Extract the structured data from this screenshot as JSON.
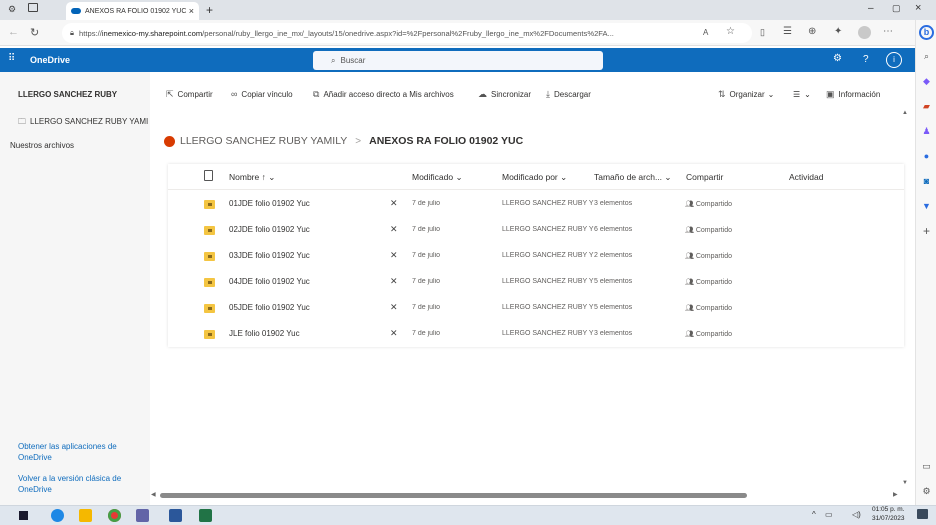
{
  "browser": {
    "tab_title": "ANEXOS RA FOLIO 01902 YUC -",
    "tab_close": "×",
    "new_tab": "+",
    "url_prefix": "https://",
    "url_host": "inemexico-my.sharepoint.com",
    "url_path": "/personal/ruby_llergo_ine_mx/_layouts/15/onedrive.aspx?id=%2Fpersonal%2Fruby_llergo_ine_mx%2FDocuments%2FA...",
    "window_controls": [
      "–",
      "▢",
      "×"
    ]
  },
  "suite": {
    "app_name": "OneDrive",
    "search_placeholder": "Buscar",
    "user_initial": "i",
    "help": "?"
  },
  "left_pane": {
    "user_name": "LLERGO SANCHEZ RUBY",
    "folder_item": "LLERGO SANCHEZ RUBY YAMI",
    "section": "Nuestros archivos",
    "get_apps": "Obtener las aplicaciones de OneDrive",
    "classic": "Volver a la versión clásica de OneDrive"
  },
  "commands": {
    "share": "Compartir",
    "copy_link": "Copiar vínculo",
    "add_shortcut": "Añadir acceso directo a Mis archivos",
    "sync": "Sincronizar",
    "download": "Descargar",
    "organize": "Organizar",
    "info": "Información"
  },
  "breadcrumb": {
    "root": "LLERGO SANCHEZ RUBY YAMILY",
    "separator": ">",
    "current": "ANEXOS RA FOLIO 01902 YUC"
  },
  "columns": {
    "name": "Nombre ↑ ⌄",
    "modified": "Modificado ⌄",
    "modified_by": "Modificado por ⌄",
    "size": "Tamaño de arch... ⌄",
    "sharing": "Compartir",
    "activity": "Actividad"
  },
  "rows": [
    {
      "name": "01JDE folio 01902 Yuc",
      "modified": "7 de julio",
      "by": "LLERGO SANCHEZ RUBY Y",
      "size": "3 elementos",
      "sharing": "Compartido"
    },
    {
      "name": "02JDE folio 01902 Yuc",
      "modified": "7 de julio",
      "by": "LLERGO SANCHEZ RUBY Y",
      "size": "6 elementos",
      "sharing": "Compartido"
    },
    {
      "name": "03JDE folio 01902 Yuc",
      "modified": "7 de julio",
      "by": "LLERGO SANCHEZ RUBY Y",
      "size": "2 elementos",
      "sharing": "Compartido"
    },
    {
      "name": "04JDE folio 01902 Yuc",
      "modified": "7 de julio",
      "by": "LLERGO SANCHEZ RUBY Y",
      "size": "5 elementos",
      "sharing": "Compartido"
    },
    {
      "name": "05JDE folio 01902 Yuc",
      "modified": "7 de julio",
      "by": "LLERGO SANCHEZ RUBY Y",
      "size": "5 elementos",
      "sharing": "Compartido"
    },
    {
      "name": "JLE folio 01902 Yuc",
      "modified": "7 de julio",
      "by": "LLERGO SANCHEZ RUBY Y",
      "size": "3 elementos",
      "sharing": "Compartido"
    }
  ],
  "taskbar": {
    "time": "01:05 p. m.",
    "date": "31/07/2023"
  },
  "colors": {
    "suite_blue": "#0f6cbd",
    "folder_yellow": "#f4c542",
    "breadcrumb_icon": "#d83b01"
  }
}
